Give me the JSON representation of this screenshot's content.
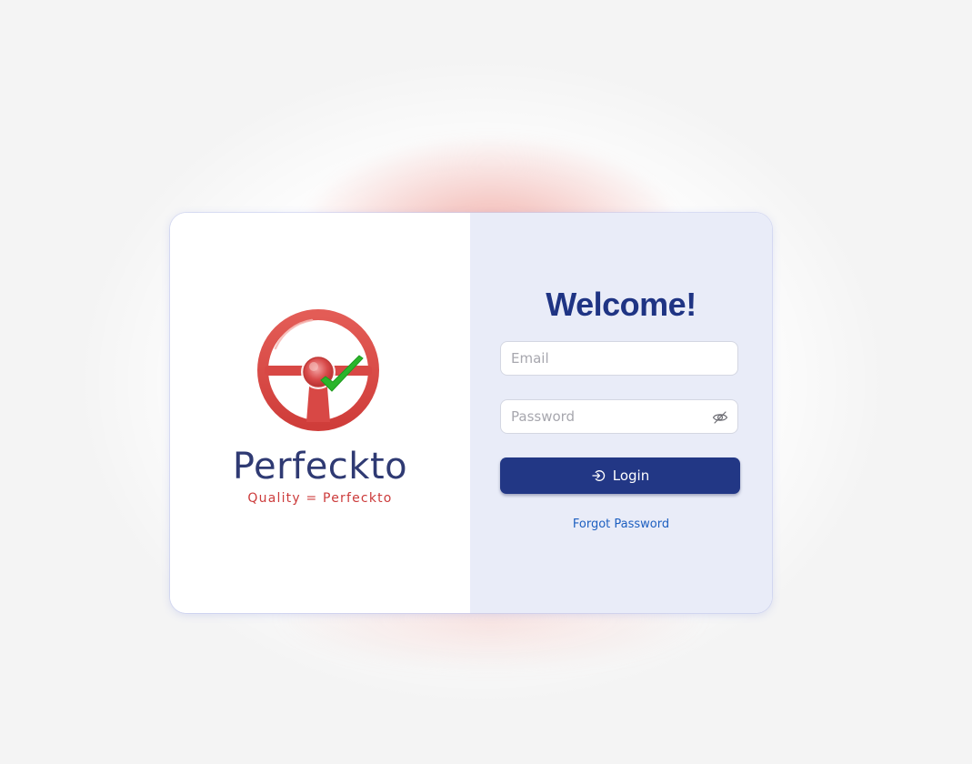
{
  "brand": {
    "name": "Perfeckto",
    "tagline": "Quality = Perfeckto",
    "logo_icon": "steering-wheel-check-icon",
    "name_color": "#2f3a73",
    "tagline_color": "#cc3b3b"
  },
  "login_panel": {
    "title": "Welcome!",
    "email": {
      "placeholder": "Email",
      "value": ""
    },
    "password": {
      "placeholder": "Password",
      "value": "",
      "toggle_icon": "eye-slash-icon"
    },
    "login_button": {
      "label": "Login",
      "icon": "login-icon",
      "color": "#223785"
    },
    "forgot_password_label": "Forgot Password",
    "panel_color": "#e9ecf8",
    "title_color": "#1f3484"
  }
}
